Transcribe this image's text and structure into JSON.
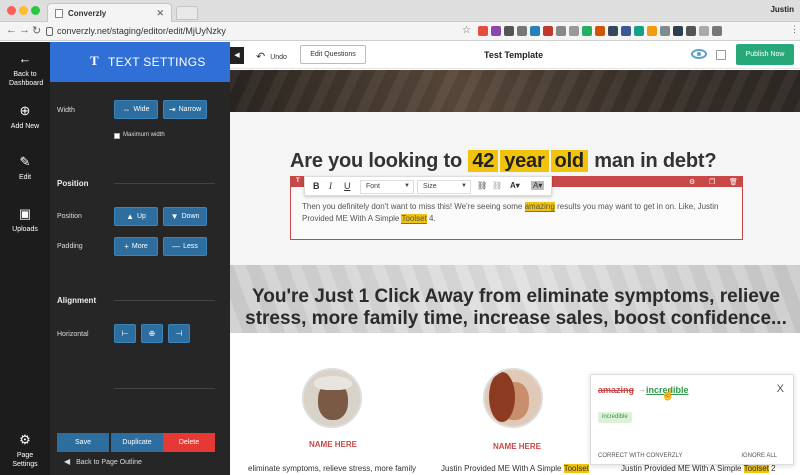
{
  "browser": {
    "tab_title": "Converzly",
    "url": "converzly.net/staging/editor/edit/MjUyNzky",
    "user": "Justin",
    "traffic_colors": [
      "#fd5f57",
      "#febc2e",
      "#28c840"
    ],
    "extension_colors": [
      "#e74c3c",
      "#8e44ad",
      "#555555",
      "#777777",
      "#2980b9",
      "#c0392b",
      "#888888",
      "#999999",
      "#27ae60",
      "#d35400",
      "#34495e",
      "#3b5998",
      "#16a085",
      "#f39c12",
      "#7f8c8d",
      "#2c3e50",
      "#555555",
      "#aaaaaa",
      "#777777"
    ]
  },
  "rail": {
    "back": "Back to Dashboard",
    "add_new": "Add New",
    "edit": "Edit",
    "uploads": "Uploads",
    "page_settings": "Page Settings"
  },
  "panel": {
    "title": "TEXT SETTINGS",
    "title_icon": "T",
    "width_label": "Width",
    "wide": "Wide",
    "narrow": "Narrow",
    "max_width": "Maximum width",
    "position_section": "Position",
    "position_label": "Position",
    "up": "Up",
    "down": "Down",
    "padding_label": "Padding",
    "more": "More",
    "less": "Less",
    "alignment_section": "Alignment",
    "horizontal_label": "Horizontal",
    "save": "Save",
    "duplicate": "Duplicate",
    "delete": "Delete",
    "back_outline": "Back to Page Outline"
  },
  "editor": {
    "undo": "Undo",
    "edit_questions": "Edit Questions",
    "template_title": "Test Template",
    "publish": "Publish Now"
  },
  "headline1": {
    "before": "Are you looking to",
    "h1": "42",
    "h2": "year",
    "h3": "old",
    "after": "man in debt?"
  },
  "toolbar": {
    "bold": "B",
    "italic": "I",
    "underline": "U",
    "font": "Font",
    "size": "Size"
  },
  "body_text": {
    "part1": "Then you definitely don't want to miss this! We're seeing some",
    "misspelled": "amazing",
    "part2": "results you may want to get in on. Like, Justin Provided ME With A Simple",
    "toolset": "Toolset",
    "part3": "4."
  },
  "headline2": "You're Just 1 Click Away from eliminate symptoms, relieve stress, more family time, increase sales, boost confidence...",
  "testimonials": {
    "name1": "NAME HERE",
    "name2": "NAME HERE",
    "text1": "eliminate symptoms, relieve stress, more family",
    "text2_pre": "Justin Provided ME With A Simple",
    "text2_hl": "Toolset",
    "text3_pre": "Justin Provided ME With A Simple",
    "text3_hl": "Toolset",
    "text3_post": "2"
  },
  "suggestion": {
    "wrong": "amazing",
    "arrow": "→",
    "right": "incredible",
    "chip": "incredible",
    "correct_with": "CORRECT WITH CONVERZLY",
    "ignore_all": "IGNORE ALL",
    "close": "X"
  },
  "colors": {
    "accent_blue": "#2f6fd6",
    "button_blue": "#2e6e9e",
    "highlight_yellow": "#f2c30c",
    "editor_red": "#c84848",
    "publish_green": "#27a879",
    "delete_red": "#e53935"
  }
}
